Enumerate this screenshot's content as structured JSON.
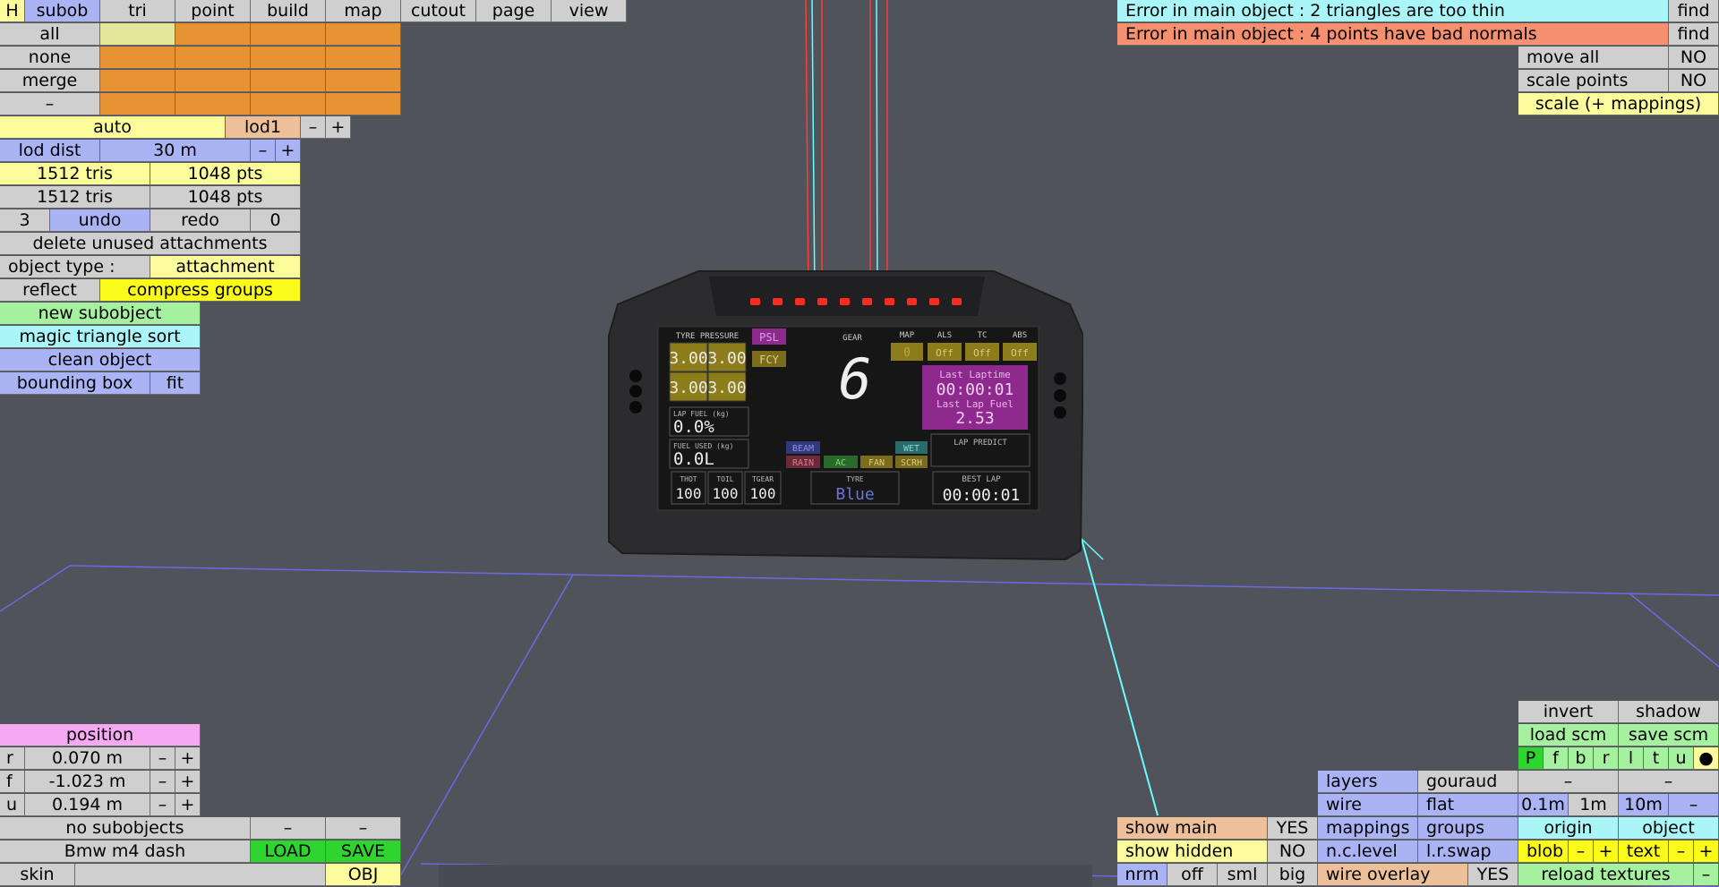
{
  "menu": {
    "h": "H",
    "subob": "subob",
    "tri": "tri",
    "point": "point",
    "build": "build",
    "map": "map",
    "cutout": "cutout",
    "page": "page",
    "view": "view"
  },
  "left": {
    "all": "all",
    "none": "none",
    "merge": "merge",
    "dash": "–",
    "auto": "auto",
    "lod": "lod1",
    "minus": "–",
    "plus": "+",
    "lod_dist_label": "lod dist",
    "lod_dist_value": "30 m",
    "tris1": "1512 tris",
    "pts1": "1048 pts",
    "tris2": "1512 tris",
    "pts2": "1048 pts",
    "undo_count": "3",
    "undo": "undo",
    "redo": "redo",
    "redo_count": "0",
    "delete_unused": "delete unused attachments",
    "object_type_label": "object type :",
    "object_type_value": "attachment",
    "reflect": "reflect",
    "compress_groups": "compress groups",
    "new_subobject": "new subobject",
    "magic_sort": "magic triangle sort",
    "clean_object": "clean object",
    "bounding_box": "bounding box",
    "fit": "fit"
  },
  "errors": {
    "e1": "Error in main object : 2 triangles are too thin",
    "e2": "Error in main object : 4 points have bad normals",
    "find": "find"
  },
  "right_top": {
    "move_all": "move all",
    "move_all_val": "NO",
    "scale_points": "scale points",
    "scale_points_val": "NO",
    "scale_mappings": "scale (+ mappings)"
  },
  "position": {
    "title": "position",
    "r_label": "r",
    "r_value": "0.070 m",
    "f_label": "f",
    "f_value": "-1.023 m",
    "u_label": "u",
    "u_value": "0.194 m",
    "minus": "–",
    "plus": "+"
  },
  "bottom_left": {
    "no_subobjects": "no subobjects",
    "dash": "–",
    "name": "Bmw m4 dash",
    "load": "LOAD",
    "save": "SAVE",
    "skin": "skin",
    "obj": "OBJ"
  },
  "right_bottom": {
    "invert": "invert",
    "shadow": "shadow",
    "load_scm": "load scm",
    "save_scm": "save scm",
    "views": [
      "P",
      "f",
      "b",
      "r",
      "l",
      "t",
      "u",
      "●"
    ],
    "layers": "layers",
    "gouraud": "gouraud",
    "dash": "–",
    "wire": "wire",
    "flat": "flat",
    "s01": "0.1m",
    "s1": "1m",
    "s10": "10m",
    "mappings": "mappings",
    "groups": "groups",
    "origin": "origin",
    "object": "object",
    "nc_level": "n.c.level",
    "lr_swap": "l.r.swap",
    "blob": "blob",
    "text": "text",
    "minus": "–",
    "plus": "+",
    "nrm": "nrm",
    "off": "off",
    "sml": "sml",
    "big": "big",
    "wire_overlay": "wire overlay",
    "yes": "YES",
    "reload_textures": "reload textures",
    "show_main": "show main",
    "show_main_val": "YES",
    "show_hidden": "show hidden",
    "show_hidden_val": "NO"
  },
  "dash": {
    "tyre_pressure": "TYRE PRESSURE",
    "tp": [
      "3.00",
      "3.00",
      "3.00",
      "3.00"
    ],
    "psl": "PSL",
    "fcy": "FCY",
    "gear_label": "GEAR",
    "gear": "6",
    "map": "MAP",
    "als": "ALS",
    "tc": "TC",
    "abs": "ABS",
    "map_val": "0",
    "als_val": "Off",
    "tc_val": "Off",
    "abs_val": "Off",
    "last_laptime_label": "Last Laptime",
    "last_laptime": "00:00:01",
    "last_lap_fuel_label": "Last Lap Fuel",
    "last_lap_fuel": "2.53",
    "lap_fuel_label": "LAP FUEL (kg)",
    "lap_fuel": "0.0%",
    "fuel_used_label": "FUEL USED (kg)",
    "fuel_used": "0.0L",
    "beam": "BEAM",
    "rain": "RAIN",
    "ac": "AC",
    "fan": "FAN",
    "wet": "WET",
    "scrh": "SCRH",
    "lap_predict": "LAP PREDICT",
    "thot": "THOT",
    "toil": "TOIL",
    "tgear": "TGEAR",
    "thot_val": "100",
    "toil_val": "100",
    "tgear_val": "100",
    "tyre_label": "TYRE",
    "tyre": "Blue",
    "best_lap_label": "BEST LAP",
    "best_lap": "00:00:01"
  }
}
